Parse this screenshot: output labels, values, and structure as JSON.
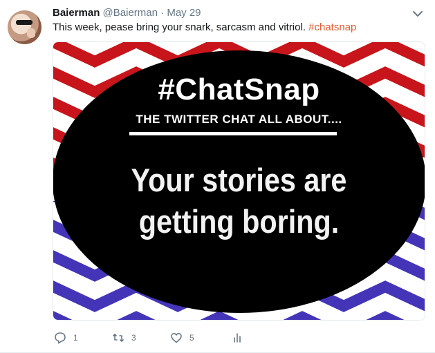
{
  "tweet": {
    "author_name": "Baierman",
    "author_handle": "@Baierman",
    "separator": "·",
    "date": "May 29",
    "text": "This week, pease bring your snark, sarcasm and vitriol.",
    "hashtag": "#chatsnap"
  },
  "media": {
    "title": "#ChatSnap",
    "subtitle": "THE TWITTER CHAT ALL ABOUT....",
    "line1": "Your stories are",
    "line2": "getting boring."
  },
  "actions": {
    "replies": "1",
    "retweets": "3",
    "likes": "5"
  },
  "colors": {
    "hashtag": "#e0592a",
    "chevron_top": "#c8151b",
    "chevron_bottom": "#4435b8",
    "oval": "#000000",
    "meta_gray": "#657786"
  },
  "icons": [
    "reply-icon",
    "retweet-icon",
    "like-icon",
    "analytics-icon",
    "chevron-down-icon"
  ]
}
